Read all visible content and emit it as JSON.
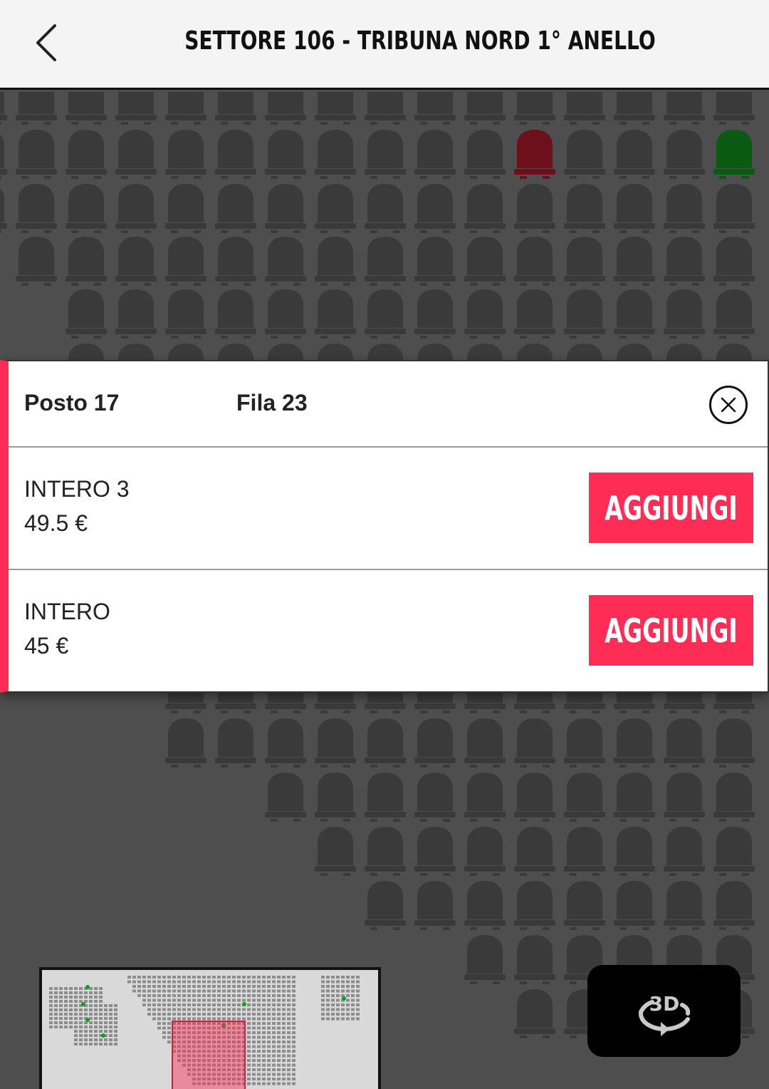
{
  "header": {
    "title": "SETTORE 106 - TRIBUNA NORD 1° ANELLO",
    "back_icon": "chevron-left-icon"
  },
  "seat_map": {
    "colors": {
      "background": "#4e4e4e",
      "available": "#3a3a3a",
      "selected": "#6e0f1c",
      "highlight": "#0b5a14"
    }
  },
  "seat_panel": {
    "seat": "Posto 17",
    "row": "Fila 23",
    "close_icon": "close-icon",
    "accent": "#ff2d55",
    "prices": [
      {
        "name": "INTERO 3",
        "price": "49.5 €",
        "button": "AGGIUNGI"
      },
      {
        "name": "INTERO",
        "price": "45 €",
        "button": "AGGIUNGI"
      }
    ]
  },
  "minimap": {
    "icon": "stadium-minimap"
  },
  "view3d": {
    "label": "3D",
    "icon": "rotate-3d-icon"
  }
}
